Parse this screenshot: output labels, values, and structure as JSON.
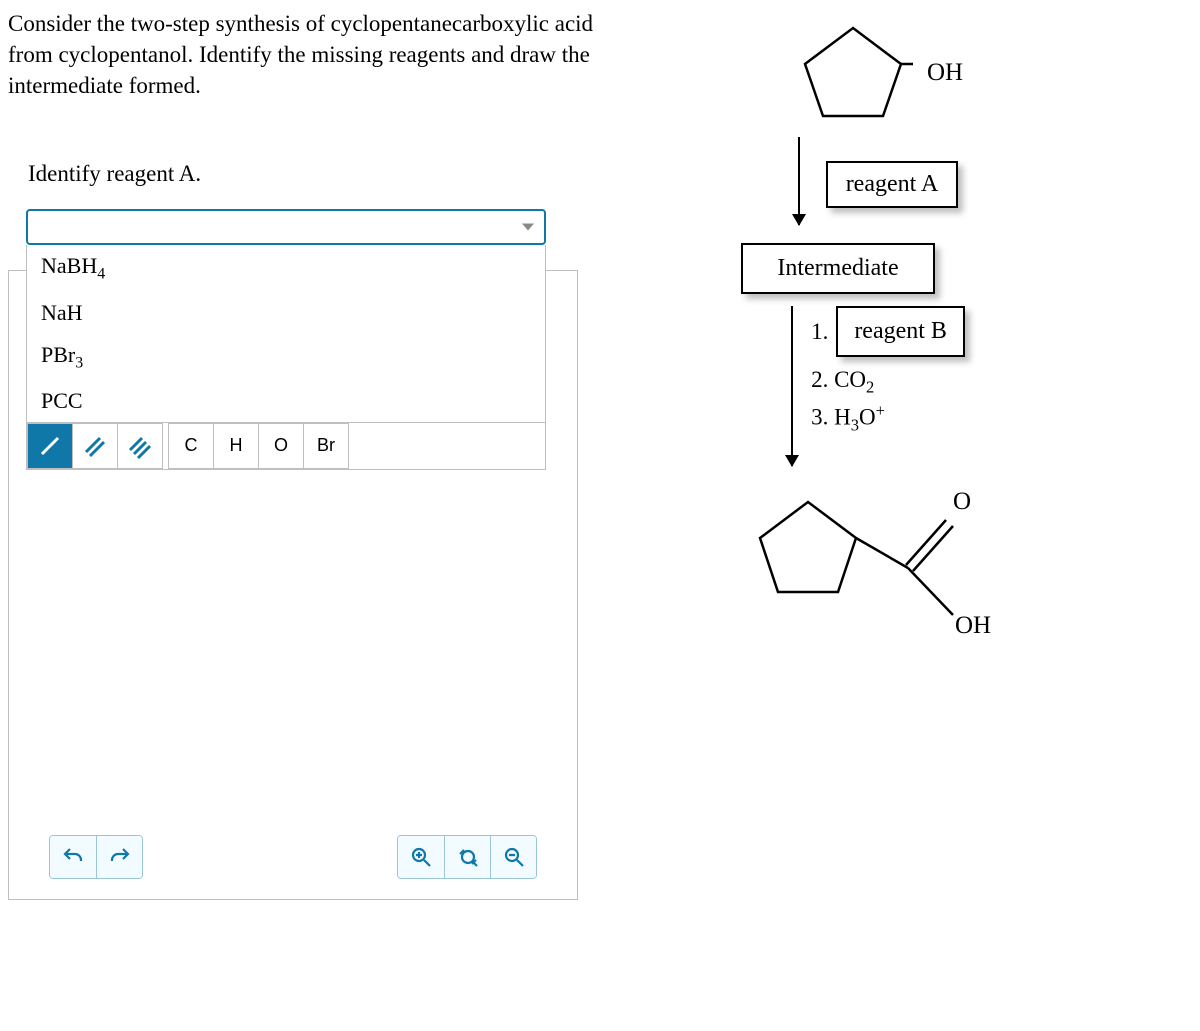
{
  "problem": {
    "text": "Consider the two-step synthesis of cyclopentanecarboxylic acid from cyclopentanol. Identify the missing reagents and draw the intermediate formed."
  },
  "sub_prompt": "Identify reagent A.",
  "dropdown": {
    "options": [
      {
        "label_html": "NaBH<sub class='sub'>4</sub>",
        "value": "NaBH4"
      },
      {
        "label_html": "NaH",
        "value": "NaH"
      },
      {
        "label_html": "PBr<sub class='sub'>3</sub>",
        "value": "PBr3"
      },
      {
        "label_html": "PCC",
        "value": "PCC"
      }
    ]
  },
  "bond_tools": {
    "single": "single-bond",
    "double": "double-bond",
    "triple": "triple-bond"
  },
  "atom_tools": [
    "C",
    "H",
    "O",
    "Br"
  ],
  "bottom_icons": {
    "undo": "undo",
    "redo": "redo",
    "zoom_in": "zoom-in",
    "zoom_fit": "zoom-fit",
    "zoom_out": "zoom-out"
  },
  "scheme": {
    "start_label": "OH",
    "reagent_a": "reagent A",
    "intermediate": "Intermediate",
    "step1_prefix": "1.",
    "reagent_b": "reagent B",
    "step2_html": "2. CO<sub class='sub'>2</sub>",
    "step3_html": "3. H<sub class='sub'>3</sub>O<sup class='sup'>+</sup>",
    "product_o": "O",
    "product_oh": "OH"
  }
}
